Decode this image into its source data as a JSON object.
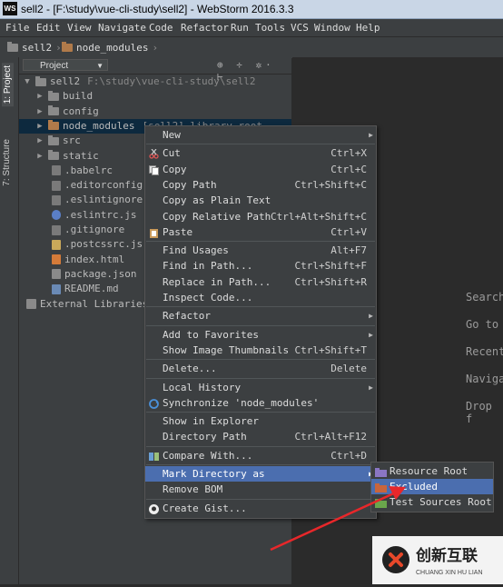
{
  "window": {
    "app_icon": "WS",
    "title": "sell2 - [F:\\study\\vue-cli-study\\sell2] - WebStorm 2016.3.3"
  },
  "menubar": [
    "File",
    "Edit",
    "View",
    "Navigate",
    "Code",
    "Refactor",
    "Run",
    "Tools",
    "VCS",
    "Window",
    "Help"
  ],
  "breadcrumb": [
    "sell2",
    "node_modules"
  ],
  "toolstrip": {
    "project": "1: Project",
    "structure": "7: Structure"
  },
  "project_panel": {
    "selector": "Project",
    "tools": "⊕ ÷ ✲· ⊢",
    "tree": [
      {
        "label": "sell2",
        "extra": "F:\\study\\vue-cli-study\\sell2",
        "arrow": "▼",
        "icon": "folder"
      },
      {
        "label": "build",
        "arrow": "▶",
        "icon": "folder"
      },
      {
        "label": "config",
        "arrow": "▶",
        "icon": "folder"
      },
      {
        "label": "node_modules",
        "extra": "[sell2]  library root",
        "arrow": "▶",
        "icon": "folder-orange"
      },
      {
        "label": "src",
        "arrow": "▶",
        "icon": "folder"
      },
      {
        "label": "static",
        "arrow": "▶",
        "icon": "folder"
      },
      {
        "label": ".babelrc",
        "icon": "rc"
      },
      {
        "label": ".editorconfig",
        "icon": "rc"
      },
      {
        "label": ".eslintignore",
        "icon": "rc"
      },
      {
        "label": ".eslintrc.js",
        "icon": "lint"
      },
      {
        "label": ".gitignore",
        "icon": "rc"
      },
      {
        "label": ".postcssrc.js",
        "icon": "js"
      },
      {
        "label": "index.html",
        "icon": "html"
      },
      {
        "label": "package.json",
        "icon": "json"
      },
      {
        "label": "README.md",
        "icon": "md"
      },
      {
        "label": "External Libraries",
        "icon": "lib"
      }
    ]
  },
  "editor_hints": [
    "Search",
    "Go to",
    "Recent",
    "Naviga",
    "Drop f"
  ],
  "context_menu": [
    {
      "label": "New",
      "submenu": true
    },
    {
      "sep": true
    },
    {
      "label": "Cut",
      "shortcut": "Ctrl+X",
      "icon": "scissors-icon"
    },
    {
      "label": "Copy",
      "shortcut": "Ctrl+C",
      "icon": "copy-icon"
    },
    {
      "label": "Copy Path",
      "shortcut": "Ctrl+Shift+C"
    },
    {
      "label": "Copy as Plain Text"
    },
    {
      "label": "Copy Relative Path",
      "shortcut": "Ctrl+Alt+Shift+C"
    },
    {
      "label": "Paste",
      "shortcut": "Ctrl+V",
      "icon": "paste-icon"
    },
    {
      "sep": true
    },
    {
      "label": "Find Usages",
      "shortcut": "Alt+F7"
    },
    {
      "label": "Find in Path...",
      "shortcut": "Ctrl+Shift+F"
    },
    {
      "label": "Replace in Path...",
      "shortcut": "Ctrl+Shift+R"
    },
    {
      "label": "Inspect Code..."
    },
    {
      "sep": true
    },
    {
      "label": "Refactor",
      "submenu": true
    },
    {
      "sep": true
    },
    {
      "label": "Add to Favorites",
      "submenu": true
    },
    {
      "label": "Show Image Thumbnails",
      "shortcut": "Ctrl+Shift+T"
    },
    {
      "sep": true
    },
    {
      "label": "Delete...",
      "shortcut": "Delete"
    },
    {
      "sep": true
    },
    {
      "label": "Local History",
      "submenu": true
    },
    {
      "label": "Synchronize 'node_modules'",
      "icon": "sync-icon"
    },
    {
      "sep": true
    },
    {
      "label": "Show in Explorer"
    },
    {
      "label": "Directory Path",
      "shortcut": "Ctrl+Alt+F12"
    },
    {
      "sep": true
    },
    {
      "label": "Compare With...",
      "shortcut": "Ctrl+D",
      "icon": "compare-icon"
    },
    {
      "sep": true
    },
    {
      "label": "Mark Directory as",
      "submenu": true,
      "highlighted": true
    },
    {
      "label": "Remove BOM"
    },
    {
      "sep": true
    },
    {
      "label": "Create Gist...",
      "icon": "github-icon"
    }
  ],
  "submenu": [
    {
      "label": "Resource Root",
      "icon": "purple"
    },
    {
      "label": "Excluded",
      "icon": "orange",
      "highlighted": true
    },
    {
      "label": "Test Sources Root",
      "icon": "green"
    }
  ],
  "watermark": {
    "name": "创新互联",
    "sub": "CHUANG XIN HU LIAN"
  },
  "colors": {
    "highlight": "#4b6eaf",
    "arrow": "#e8272a",
    "bg": "#2b2b2b",
    "panel": "#3c3f41"
  }
}
